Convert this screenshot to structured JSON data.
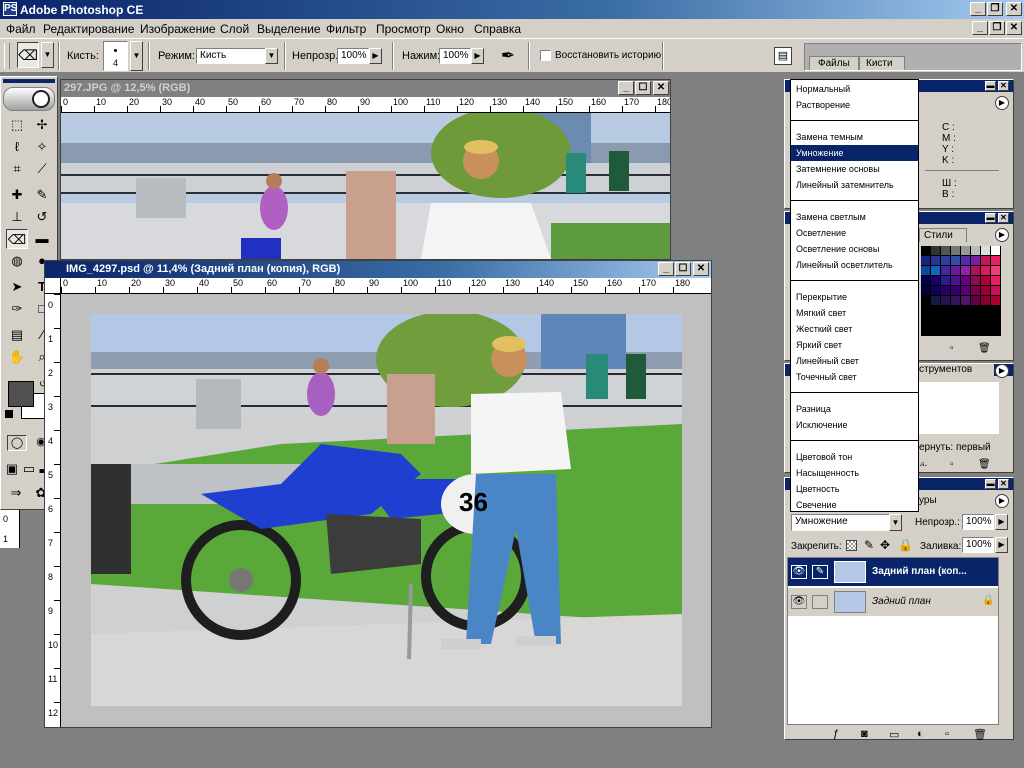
{
  "app": {
    "title": "Adobe Photoshop CE",
    "logo": "PS",
    "window_buttons": [
      "_",
      "❐",
      "✕"
    ]
  },
  "menu": [
    "Файл",
    "Редактирование",
    "Изображение",
    "Слой",
    "Выделение",
    "Фильтр",
    "Просмотр",
    "Окно",
    "Справка"
  ],
  "options": {
    "brush_label": "Кисть:",
    "brush_size": "4",
    "mode_label": "Режим:",
    "mode_value": "Кисть",
    "opacity_label": "Непрозр.:",
    "opacity_value": "100%",
    "pressure_label": "Нажим:",
    "pressure_value": "100%",
    "restore_history": "Восстановить историю",
    "tab_files": "Файлы",
    "tab_brushes": "Кисти"
  },
  "doc1": {
    "title": "297.JPG @ 12,5% (RGB)",
    "ruler": [
      "0",
      "10",
      "20",
      "30",
      "40",
      "50",
      "60",
      "70",
      "80",
      "90",
      "100",
      "110",
      "120",
      "130",
      "140",
      "150",
      "160",
      "170",
      "180"
    ]
  },
  "doc2": {
    "title": "IMG_4297.psd @ 11,4% (Задний план (копия), RGB)",
    "ruler": [
      "0",
      "10",
      "20",
      "30",
      "40",
      "50",
      "60",
      "70",
      "80",
      "90",
      "100",
      "110",
      "120",
      "130",
      "140",
      "150",
      "160",
      "170",
      "180"
    ],
    "vruler": [
      "0",
      "1",
      "2",
      "3",
      "4",
      "5",
      "6",
      "7",
      "8",
      "9",
      "10",
      "11",
      "12"
    ],
    "bib": "36"
  },
  "left_vruler": [
    "0",
    "1"
  ],
  "blend_menu": [
    "Нормальный",
    "Растворение",
    "Замена темным",
    "Умножение",
    "Затемнение основы",
    "Линейный затемнитель",
    "Замена светлым",
    "Осветление",
    "Осветление основы",
    "Линейный осветлитель",
    "Перекрытие",
    "Мягкий свет",
    "Жесткий свет",
    "Яркий свет",
    "Линейный свет",
    "Точечный свет",
    "Разница",
    "Исключение",
    "Цветовой тон",
    "Насыщенность",
    "Цветность",
    "Свечение"
  ],
  "blend_selected": "Умножение",
  "info": {
    "cmyk": [
      "C :",
      "M :",
      "Y :",
      "K :"
    ],
    "wb": [
      "Ш :",
      "В :"
    ]
  },
  "swatches": {
    "tab_styles": "Стили"
  },
  "history": {
    "tab_fragment": "струментов",
    "item_fragment": "ернуть: первый ..."
  },
  "layers": {
    "tab_fragment": "уры",
    "blend_mode": "Умножение",
    "opacity_label": "Непрозр.:",
    "opacity_value": "100%",
    "lock_label": "Закрепить:",
    "fill_label": "Заливка:",
    "fill_value": "100%",
    "items": [
      {
        "name": "Задний план (коп...",
        "selected": true
      },
      {
        "name": "Задний план",
        "selected": false
      }
    ]
  },
  "colors": {
    "titlebar_active": "#0a246a",
    "titlebar_inactive": "#808080",
    "face": "#d4d0c8",
    "motorcycle": "#1f3fd0",
    "highlight": "#0a246a"
  }
}
